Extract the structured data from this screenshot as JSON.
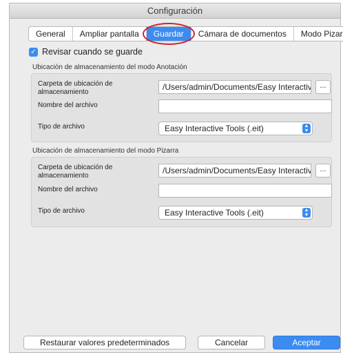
{
  "window": {
    "title": "Configuración"
  },
  "tabs": [
    {
      "label": "General"
    },
    {
      "label": "Ampliar pantalla"
    },
    {
      "label": "Guardar"
    },
    {
      "label": "Cámara de documentos"
    },
    {
      "label": "Modo Pizarra"
    }
  ],
  "active_tab": "Guardar",
  "checkbox": {
    "label": "Revisar cuando se guarde",
    "checked": true
  },
  "annotation": {
    "title": "Ubicación de almacenamiento del modo Anotación",
    "folder_label": "Carpeta de ubicación de almacenamiento",
    "folder_value": "/Users/admin/Documents/Easy Interactive T",
    "browse_label": "...",
    "filename_label": "Nombre del archivo",
    "filename_value": "",
    "filetype_label": "Tipo de archivo",
    "filetype_value": "Easy Interactive Tools (.eit)"
  },
  "whiteboard": {
    "title": "Ubicación de almacenamiento del modo Pizarra",
    "folder_label": "Carpeta de ubicación de almacenamiento",
    "folder_value": "/Users/admin/Documents/Easy Interactive T",
    "browse_label": "...",
    "filename_label": "Nombre del archivo",
    "filename_value": "",
    "filetype_label": "Tipo de archivo",
    "filetype_value": "Easy Interactive Tools (.eit)"
  },
  "footer": {
    "restore_label": "Restaurar valores predeterminados",
    "cancel_label": "Cancelar",
    "accept_label": "Aceptar"
  },
  "colors": {
    "accent": "#3c8cf0",
    "highlight_circle": "#d1222b"
  }
}
